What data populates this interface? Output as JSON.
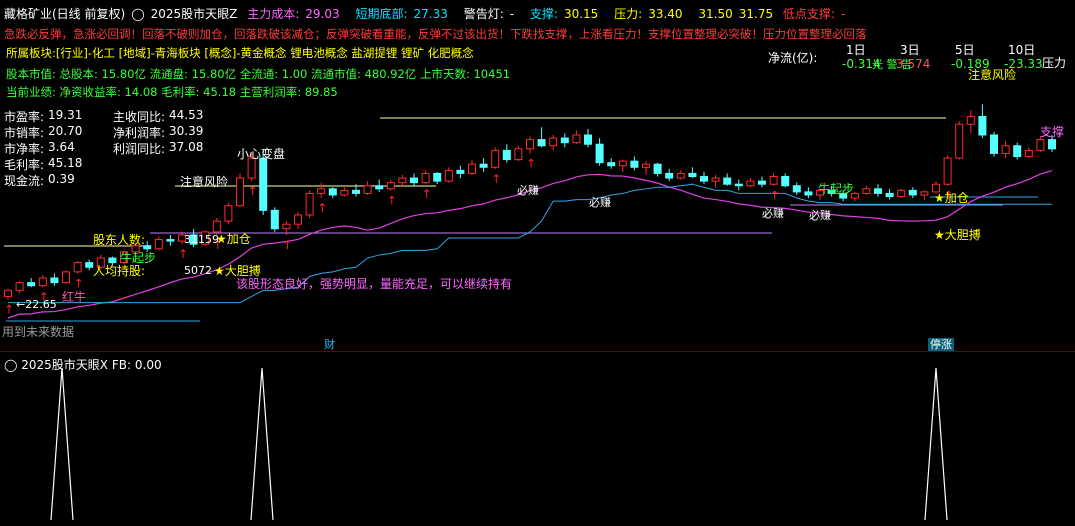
{
  "top_panel": {
    "title": "藏格矿业(日线 前复权)",
    "indicator": "2025股市天眼Z",
    "main_cost_label": "主力成本:",
    "main_cost": "29.03",
    "short_bottom_label": "短期底部:",
    "short_bottom": "27.33",
    "alarm_label": "警告灯:",
    "alarm": "-",
    "support_label": "支撑:",
    "support": "30.15",
    "pressure_label": "压力:",
    "pressure": "33.40",
    "p2": "31.50",
    "p3": "31.75",
    "low_support_label": "低点支撑:",
    "low_support": "-"
  },
  "advice": "急跌必反弹，急涨必回调！回落不破则加仓，回落跌破该减仓；反弹突破看重能，反弹不过该出货！下跌找支撑，上涨看压力！支撑位置整理必突破！压力位置整理必回落",
  "sector": "所属板块:[行业]-化工 [地域]-青海板块 [概念]-黄金概念 锂电池概念 盐湖提锂 锂矿 化肥概念",
  "market": "股本市值: 总股本: 15.80亿 流通盘: 15.80亿 全流通: 1.00 流通市值: 480.92亿 上市天数: 10451",
  "perf": "当前业绩: 净资收益率: 14.08 毛利率: 45.18 主营利润率: 89.85",
  "ratios": [
    {
      "label": "市盈率:",
      "value": "19.31"
    },
    {
      "label": "市销率:",
      "value": "20.70"
    },
    {
      "label": "市净率:",
      "value": "3.64"
    },
    {
      "label": "毛利率:",
      "value": "45.18"
    },
    {
      "label": "现金流:",
      "value": "0.39"
    }
  ],
  "growth": [
    {
      "label": "主收同比:",
      "value": "44.53"
    },
    {
      "label": "净利润率:",
      "value": "30.39"
    },
    {
      "label": "利润同比:",
      "value": "37.08"
    }
  ],
  "netflow": {
    "label": "净流(亿):",
    "headers": [
      "1日",
      "3日",
      "5日",
      "10日"
    ],
    "values": [
      "-0.314",
      "3.574",
      "-0.189",
      "-23.33"
    ]
  },
  "annotations": {
    "heart": "小心变盘",
    "warn1": "注意风险",
    "warn2": "注意风险",
    "holder": "股东人数:",
    "avg_hold": "人均持股:",
    "holder_val": "31159",
    "avg_val": "5072",
    "add1": "加仓",
    "add2": "加仓",
    "bold1": "大胆搏",
    "bold2": "大胆搏",
    "bull1": "牛起步",
    "bull2": "牛起步",
    "red_bull": "红牛",
    "low_price": "←22.65",
    "must1": "必赚",
    "must2": "必赚",
    "must3": "必赚",
    "must4": "必赚",
    "comment": "该股形态良好，强势明显，量能充足，可以继续持有",
    "future": "用到未来数据",
    "pressure_r": "压力",
    "support_r": "支撑",
    "level_r": "光 警 告"
  },
  "tags": {
    "cai": "财",
    "tingzhang": "停涨"
  },
  "bottom_panel": {
    "title": "2025股市天眼X",
    "fb_label": "FB:",
    "fb_value": "0.00"
  },
  "colors": {
    "up": "#ff2a2a",
    "down": "#54ffff",
    "ma": "#e040e0",
    "band": "#2fa6e6",
    "line": "#ffffa0"
  },
  "chart_data": {
    "type": "candlestick",
    "candles": [
      [
        22.9,
        23.4,
        22.7,
        23.3
      ],
      [
        23.3,
        23.9,
        23.1,
        23.8
      ],
      [
        23.8,
        24.1,
        23.5,
        23.6
      ],
      [
        23.6,
        24.3,
        23.5,
        24.1
      ],
      [
        24.1,
        24.4,
        23.6,
        23.8
      ],
      [
        23.8,
        24.6,
        23.7,
        24.5
      ],
      [
        24.5,
        25.2,
        24.4,
        25.1
      ],
      [
        25.1,
        25.3,
        24.6,
        24.8
      ],
      [
        24.8,
        25.6,
        24.7,
        25.4
      ],
      [
        25.4,
        25.5,
        24.9,
        25.1
      ],
      [
        25.1,
        25.9,
        25.0,
        25.8
      ],
      [
        25.8,
        26.4,
        25.6,
        26.2
      ],
      [
        26.2,
        26.5,
        25.8,
        26.0
      ],
      [
        26.0,
        26.8,
        25.9,
        26.6
      ],
      [
        26.6,
        26.9,
        26.2,
        26.5
      ],
      [
        26.5,
        27.1,
        26.3,
        26.9
      ],
      [
        26.9,
        27.3,
        26.1,
        26.3
      ],
      [
        26.3,
        27.2,
        26.2,
        27.1
      ],
      [
        27.1,
        28.0,
        26.9,
        27.8
      ],
      [
        27.8,
        29.0,
        27.6,
        28.8
      ],
      [
        28.8,
        30.9,
        28.7,
        30.6
      ],
      [
        30.6,
        32.3,
        30.4,
        31.9
      ],
      [
        31.9,
        32.5,
        28.2,
        28.5
      ],
      [
        28.5,
        28.7,
        27.1,
        27.3
      ],
      [
        27.3,
        27.8,
        26.9,
        27.6
      ],
      [
        27.6,
        28.4,
        27.3,
        28.2
      ],
      [
        28.2,
        29.8,
        28.0,
        29.6
      ],
      [
        29.6,
        30.3,
        29.3,
        29.9
      ],
      [
        29.9,
        30.0,
        29.3,
        29.5
      ],
      [
        29.5,
        30.0,
        29.4,
        29.8
      ],
      [
        29.8,
        30.2,
        29.4,
        29.6
      ],
      [
        29.6,
        30.4,
        29.5,
        30.1
      ],
      [
        30.1,
        30.5,
        29.7,
        29.9
      ],
      [
        29.9,
        30.5,
        29.8,
        30.3
      ],
      [
        30.3,
        30.8,
        30.0,
        30.6
      ],
      [
        30.6,
        30.9,
        30.1,
        30.3
      ],
      [
        30.3,
        31.1,
        30.2,
        30.9
      ],
      [
        30.9,
        31.0,
        30.2,
        30.4
      ],
      [
        30.4,
        31.3,
        30.3,
        31.1
      ],
      [
        31.1,
        31.4,
        30.6,
        30.9
      ],
      [
        30.9,
        31.8,
        30.8,
        31.5
      ],
      [
        31.5,
        31.9,
        31.0,
        31.3
      ],
      [
        31.3,
        32.6,
        31.2,
        32.4
      ],
      [
        32.4,
        32.8,
        31.6,
        31.8
      ],
      [
        31.8,
        32.7,
        31.7,
        32.5
      ],
      [
        32.5,
        33.3,
        32.2,
        33.1
      ],
      [
        33.1,
        33.9,
        32.6,
        32.7
      ],
      [
        32.7,
        33.4,
        32.4,
        33.2
      ],
      [
        33.2,
        33.5,
        32.6,
        32.9
      ],
      [
        32.9,
        33.7,
        32.8,
        33.4
      ],
      [
        33.4,
        33.8,
        32.6,
        32.8
      ],
      [
        32.8,
        33.2,
        31.4,
        31.6
      ],
      [
        31.6,
        31.9,
        31.2,
        31.4
      ],
      [
        31.4,
        31.8,
        31.0,
        31.7
      ],
      [
        31.7,
        32.0,
        31.1,
        31.3
      ],
      [
        31.3,
        31.7,
        30.8,
        31.5
      ],
      [
        31.5,
        31.6,
        30.7,
        30.9
      ],
      [
        30.9,
        31.2,
        30.4,
        30.6
      ],
      [
        30.6,
        31.1,
        30.5,
        30.9
      ],
      [
        30.9,
        31.3,
        30.6,
        30.7
      ],
      [
        30.7,
        31.0,
        30.2,
        30.4
      ],
      [
        30.4,
        30.8,
        30.0,
        30.6
      ],
      [
        30.6,
        30.9,
        30.1,
        30.2
      ],
      [
        30.2,
        30.5,
        29.8,
        30.1
      ],
      [
        30.1,
        30.6,
        30.0,
        30.4
      ],
      [
        30.4,
        30.7,
        30.0,
        30.2
      ],
      [
        30.2,
        30.9,
        30.1,
        30.7
      ],
      [
        30.7,
        30.9,
        30.0,
        30.1
      ],
      [
        30.1,
        30.3,
        29.5,
        29.7
      ],
      [
        29.7,
        30.0,
        29.3,
        29.5
      ],
      [
        29.5,
        29.9,
        29.2,
        29.8
      ],
      [
        29.8,
        30.1,
        29.4,
        29.6
      ],
      [
        29.6,
        29.8,
        29.1,
        29.3
      ],
      [
        29.3,
        29.7,
        29.1,
        29.6
      ],
      [
        29.6,
        30.1,
        29.5,
        29.9
      ],
      [
        29.9,
        30.2,
        29.4,
        29.6
      ],
      [
        29.6,
        29.9,
        29.2,
        29.4
      ],
      [
        29.4,
        29.9,
        29.3,
        29.8
      ],
      [
        29.8,
        30.0,
        29.3,
        29.5
      ],
      [
        29.5,
        29.8,
        29.2,
        29.7
      ],
      [
        29.7,
        30.4,
        29.6,
        30.2
      ],
      [
        30.2,
        32.1,
        30.1,
        31.9
      ],
      [
        31.9,
        34.3,
        31.8,
        34.1
      ],
      [
        34.1,
        35.0,
        33.5,
        34.6
      ],
      [
        34.6,
        35.4,
        33.2,
        33.4
      ],
      [
        33.4,
        33.6,
        32.0,
        32.2
      ],
      [
        32.2,
        33.0,
        31.9,
        32.7
      ],
      [
        32.7,
        32.9,
        31.8,
        32.0
      ],
      [
        32.0,
        32.6,
        31.9,
        32.4
      ],
      [
        32.4,
        33.3,
        32.3,
        33.1
      ],
      [
        33.1,
        33.4,
        32.3,
        32.5
      ]
    ]
  }
}
